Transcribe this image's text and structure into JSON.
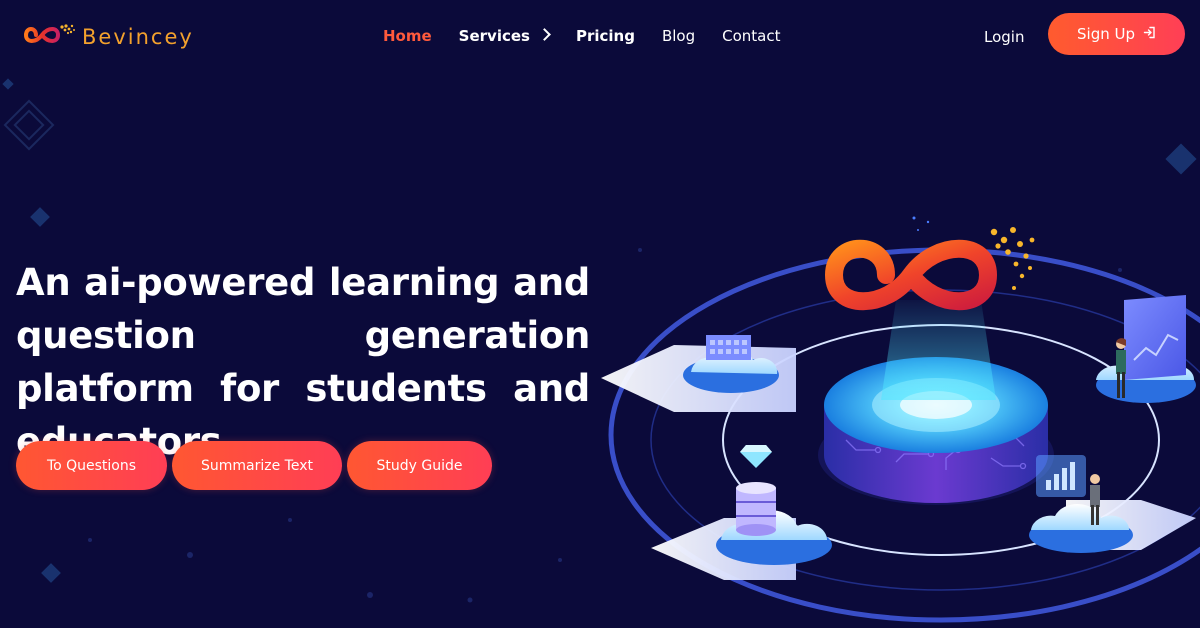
{
  "header": {
    "logo_text": "Bevincey",
    "nav": [
      {
        "label": "Home",
        "active": true
      },
      {
        "label": "Services",
        "has_submenu": true
      },
      {
        "label": "Pricing"
      },
      {
        "label": "Blog"
      },
      {
        "label": "Contact"
      }
    ],
    "login_label": "Login",
    "signup_label": "Sign Up"
  },
  "hero": {
    "headline": "An ai-powered learning and question generation platform for students and educators",
    "buttons": [
      "To Questions",
      "Summarize Text",
      "Study Guide"
    ]
  },
  "colors": {
    "background": "#0b0a3a",
    "accent": "#ff4b3c",
    "logo": "#f3a12d",
    "text": "#ffffff"
  },
  "icons": {
    "logo_mark": "infinity-logo-icon",
    "services_chevron": "chevron-right-icon",
    "signup": "sign-in-arrow-icon"
  }
}
